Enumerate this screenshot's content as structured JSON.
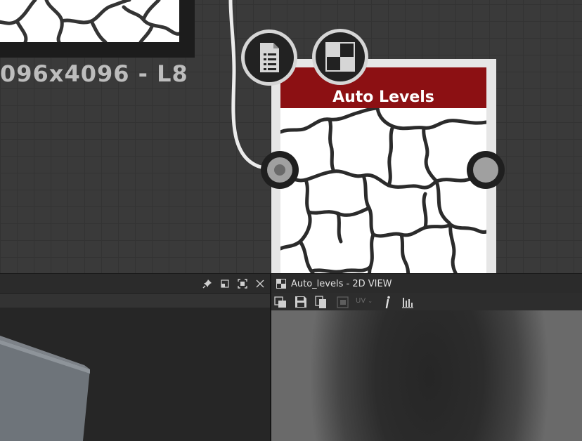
{
  "graph": {
    "previous_node": {
      "resolution_label": "096x4096 - L8"
    },
    "node": {
      "title": "Auto Levels",
      "header_color": "#8c1013",
      "badges": [
        "document-list-icon",
        "checker-icon"
      ],
      "ports": [
        "input-port",
        "output-port"
      ]
    }
  },
  "left_panel": {
    "header_icons": [
      "pin-icon",
      "restore-icon",
      "maximize-icon",
      "close-icon"
    ]
  },
  "view2d": {
    "title": "Auto_levels - 2D VIEW",
    "toolbar": {
      "uv_label": "UV",
      "icons": [
        "copy-view-icon",
        "save-icon",
        "paste-icon",
        "tiling-icon",
        "uv-dropdown",
        "info-icon",
        "histogram-icon"
      ]
    }
  }
}
